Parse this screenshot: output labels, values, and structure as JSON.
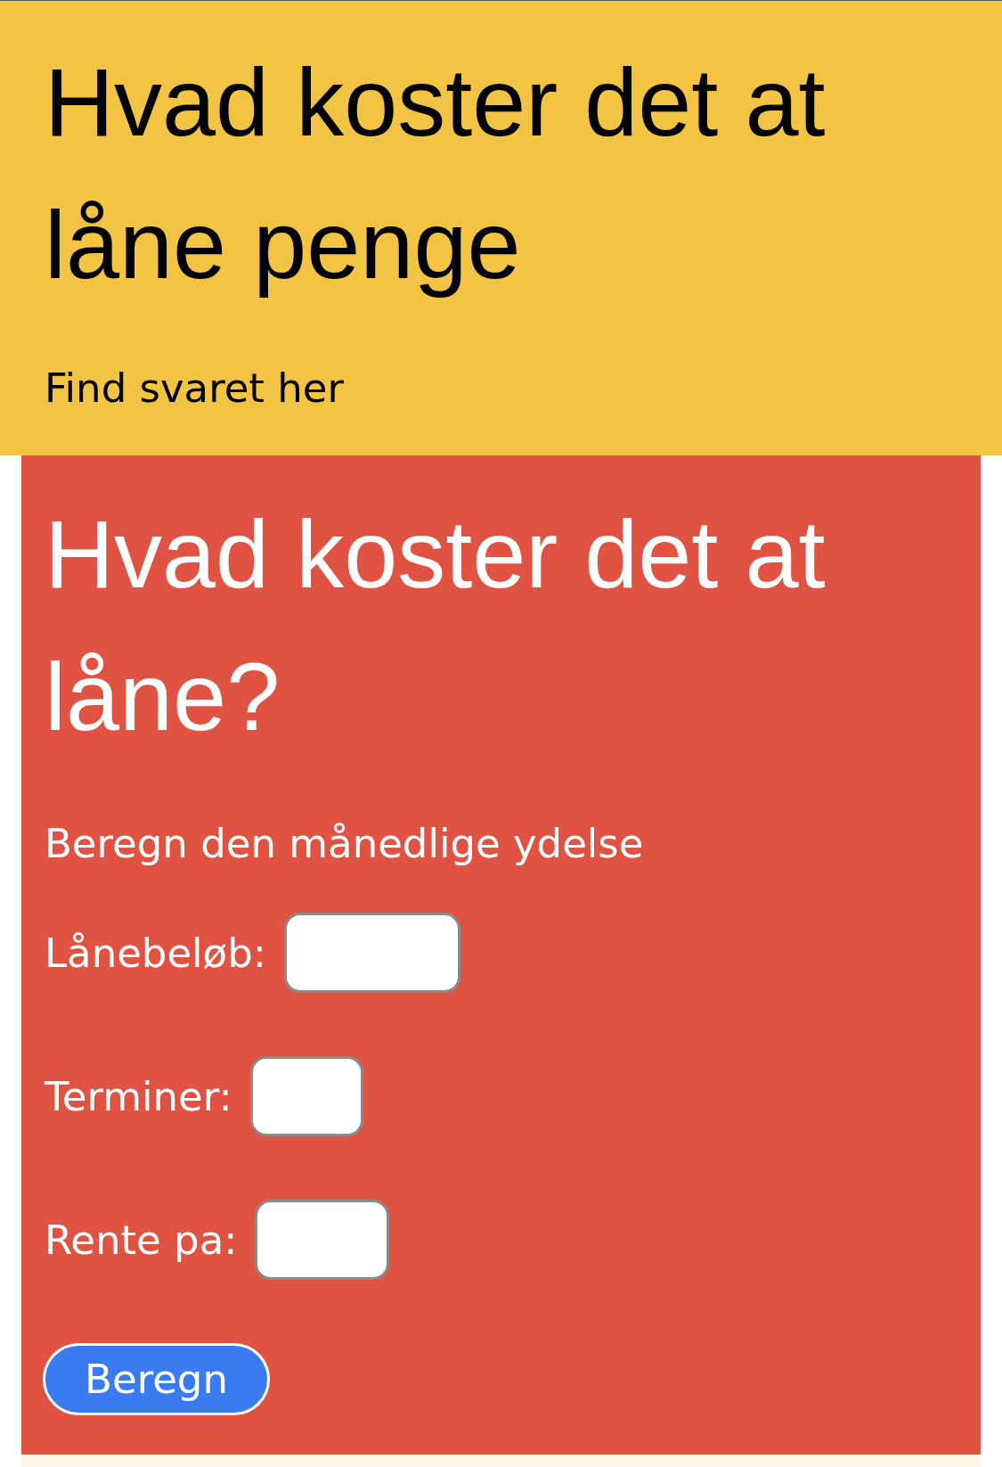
{
  "header": {
    "title": "Hvad koster det at låne penge",
    "subtitle": "Find svaret her"
  },
  "calculator": {
    "title": "Hvad koster det at låne?",
    "subtitle": "Beregn den månedlige ydelse",
    "fields": [
      {
        "label": "Lånebeløb:"
      },
      {
        "label": "Terminer:"
      },
      {
        "label": "Rente pa:"
      }
    ],
    "button": "Beregn"
  }
}
